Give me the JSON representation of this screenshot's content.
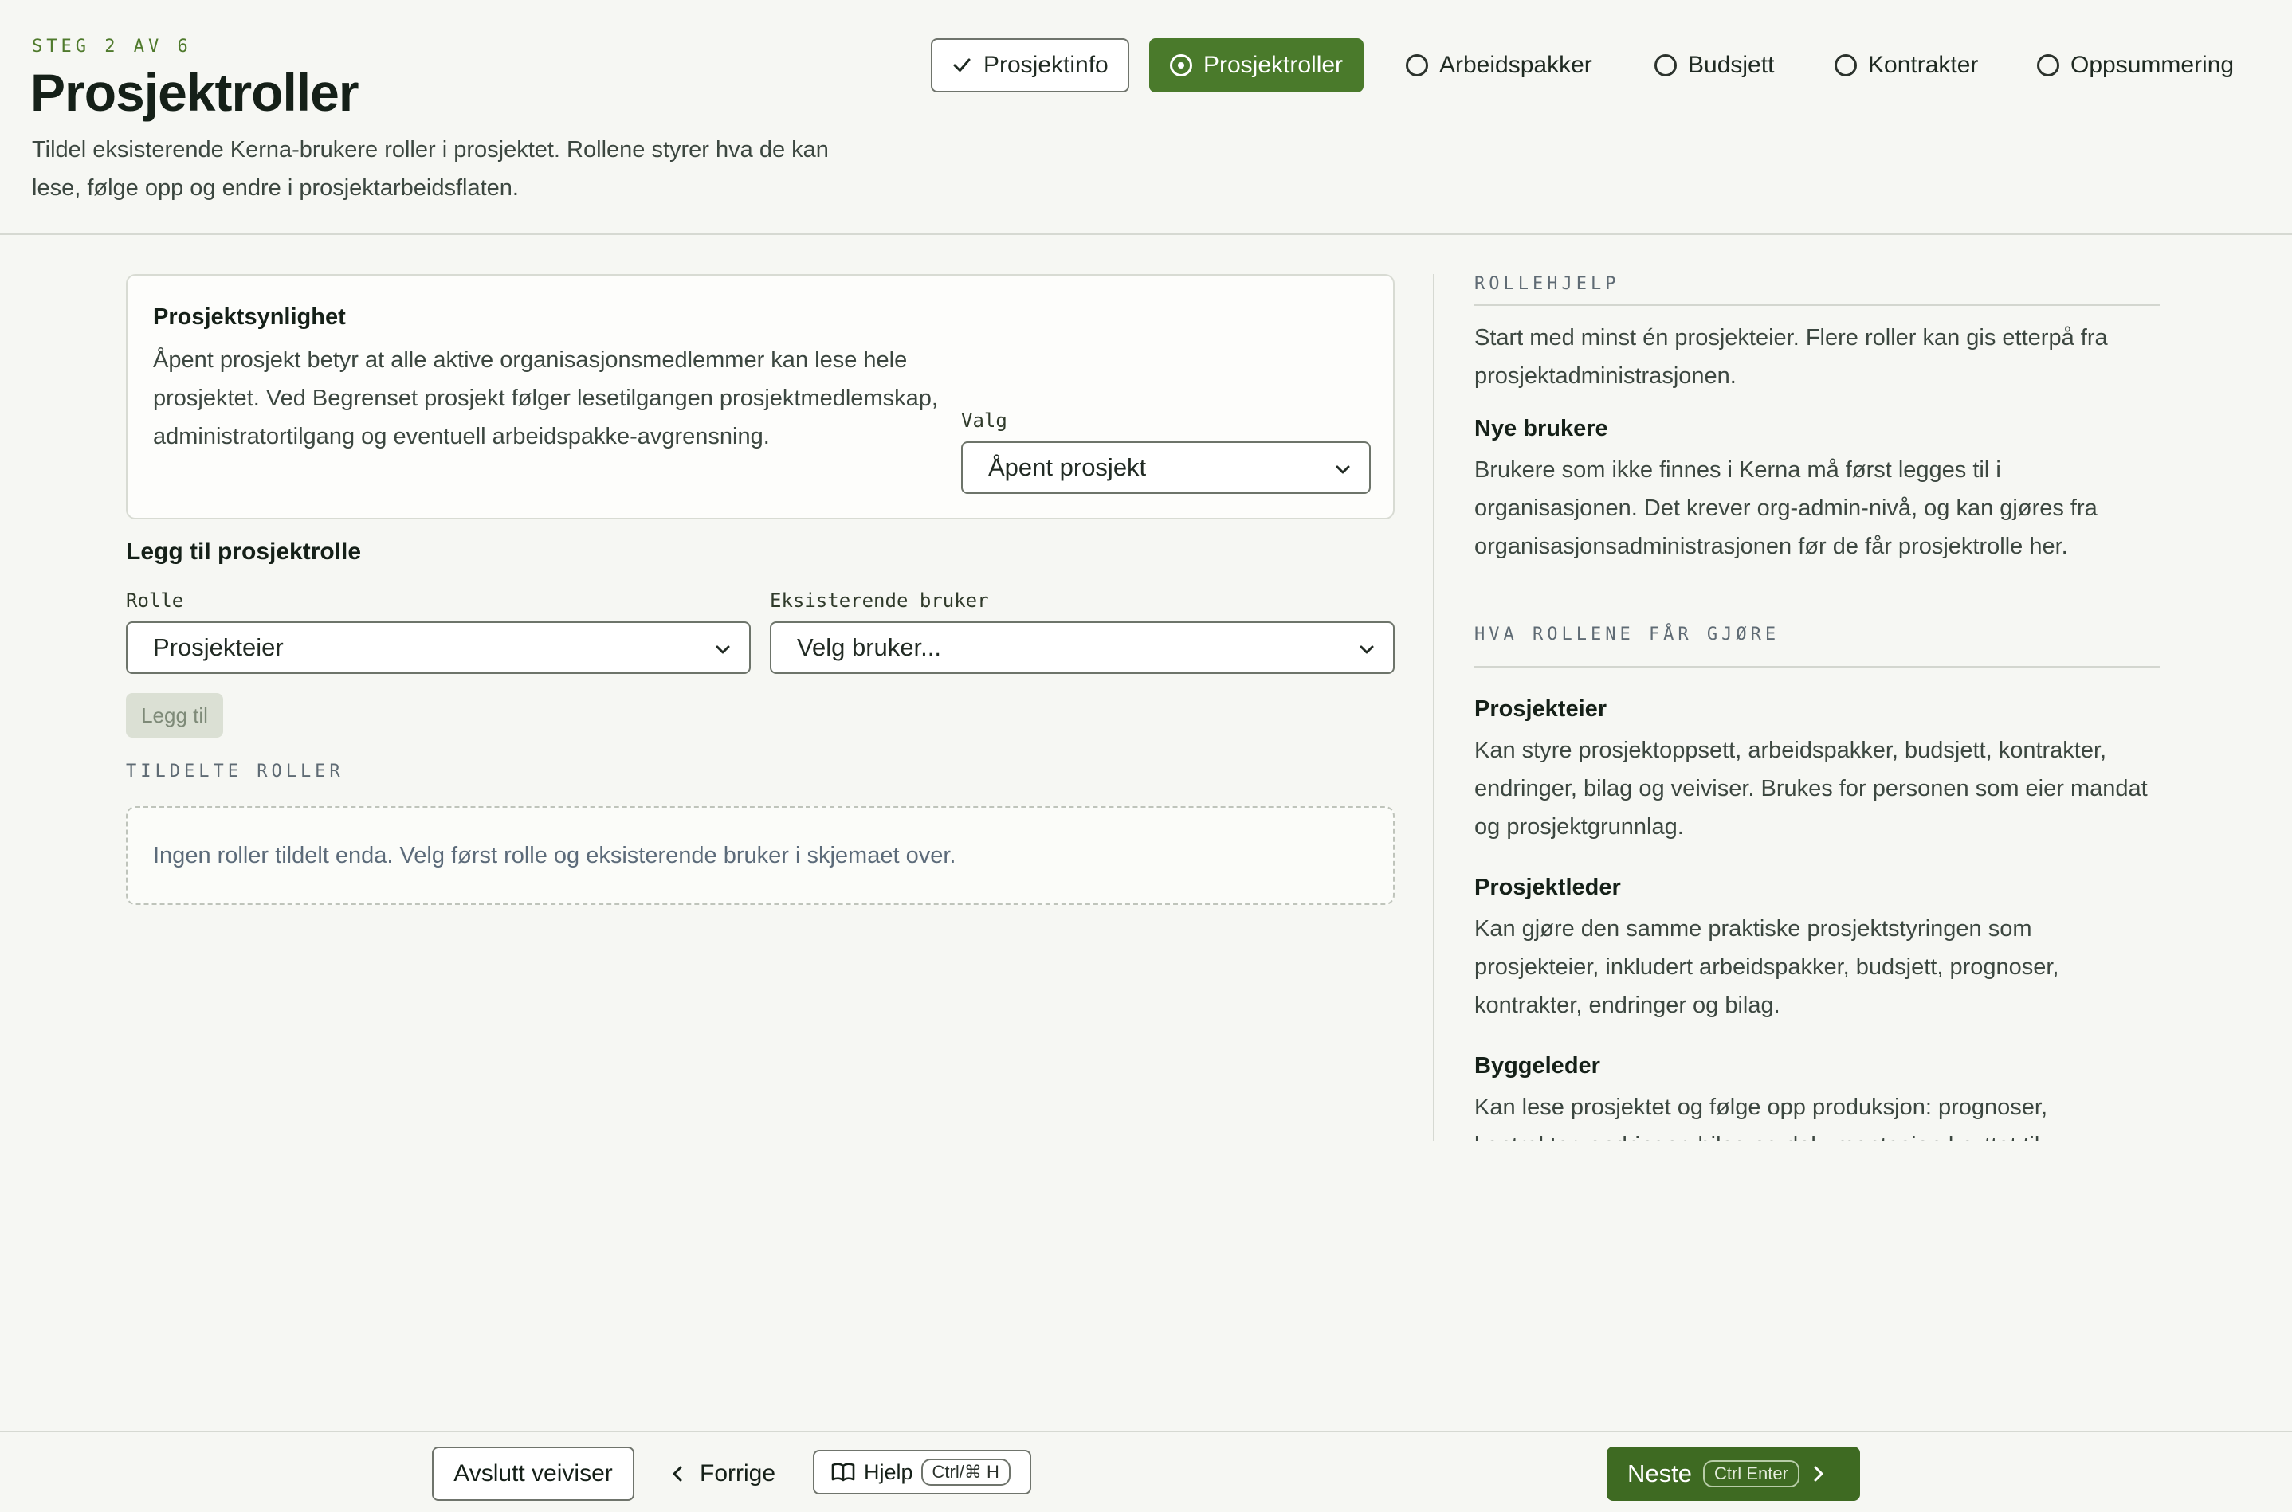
{
  "header": {
    "step_label": "STEG 2 AV 6",
    "title": "Prosjektroller",
    "description": "Tildel eksisterende Kerna-brukere roller i prosjektet. Rollene styrer hva de kan lese, følge opp og endre i prosjektarbeidsflaten."
  },
  "stepper": {
    "steps": [
      {
        "label": "Prosjektinfo",
        "state": "done"
      },
      {
        "label": "Prosjektroller",
        "state": "active"
      },
      {
        "label": "Arbeidspakker",
        "state": "pending"
      },
      {
        "label": "Budsjett",
        "state": "pending"
      },
      {
        "label": "Kontrakter",
        "state": "pending"
      },
      {
        "label": "Oppsummering",
        "state": "pending"
      }
    ]
  },
  "visibility": {
    "title": "Prosjektsynlighet",
    "text": "Åpent prosjekt betyr at alle aktive organisasjonsmedlemmer kan lese hele prosjektet. Ved Begrenset prosjekt følger lesetilgangen prosjektmedlemskap, administratortilgang og eventuell arbeidspakke-avgrensning.",
    "select_label": "Valg",
    "select_value": "Åpent prosjekt"
  },
  "add_role": {
    "title": "Legg til prosjektrolle",
    "role_label": "Rolle",
    "role_value": "Prosjekteier",
    "user_label": "Eksisterende bruker",
    "user_value": "Velg bruker...",
    "add_button": "Legg til"
  },
  "assigned": {
    "heading": "TILDELTE ROLLER",
    "empty_text": "Ingen roller tildelt enda. Velg først rolle og eksisterende bruker i skjemaet over."
  },
  "help": {
    "heading": "ROLLEHJELP",
    "intro": "Start med minst én prosjekteier. Flere roller kan gis etterpå fra prosjektadministrasjonen.",
    "new_users_title": "Nye brukere",
    "new_users_text": "Brukere som ikke finnes i Kerna må først legges til i organisasjonen. Det krever org-admin-nivå, og kan gjøres fra organisasjonsadministrasjonen før de får prosjektrolle her.",
    "roles_heading": "HVA ROLLENE FÅR GJØRE",
    "roles": [
      {
        "title": "Prosjekteier",
        "text": "Kan styre prosjektoppsett, arbeidspakker, budsjett, kontrakter, endringer, bilag og veiviser. Brukes for personen som eier mandat og prosjektgrunnlag."
      },
      {
        "title": "Prosjektleder",
        "text": "Kan gjøre den samme praktiske prosjektstyringen som prosjekteier, inkludert arbeidspakker, budsjett, prognoser, kontrakter, endringer og bilag."
      },
      {
        "title": "Byggeleder",
        "text": "Kan lese prosjektet og følge opp produksjon: prognoser, kontrakter, endringer, bilag og dokumentasjon knyttet til kontraktene."
      }
    ]
  },
  "footer": {
    "exit_button": "Avslutt veiviser",
    "prev_button": "Forrige",
    "help_button": "Hjelp",
    "help_shortcut": "Ctrl/⌘ H",
    "next_button": "Neste",
    "next_shortcut": "Ctrl Enter"
  },
  "colors": {
    "accent": "#4a7a2b",
    "accent_dark": "#3e6a22",
    "background": "#f6f7f3"
  }
}
